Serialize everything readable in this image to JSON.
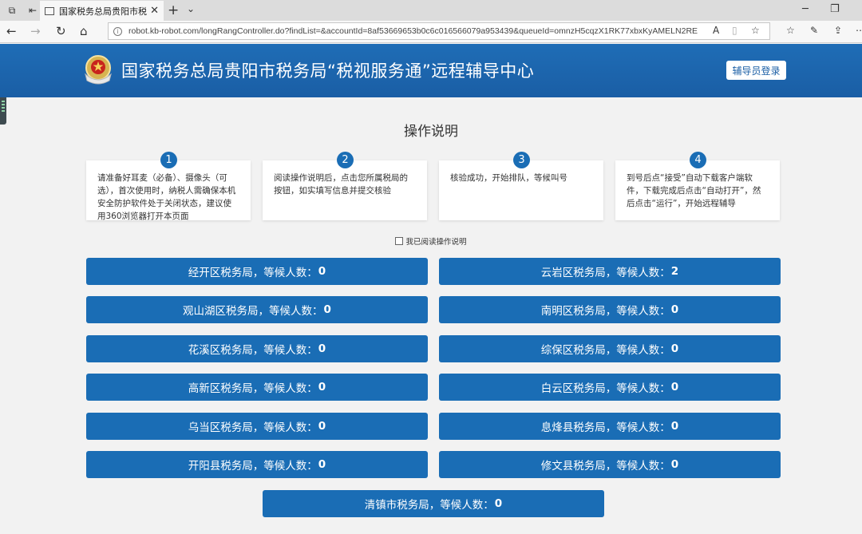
{
  "browser": {
    "tab_title": "国家税务总局贵阳市税务局“税视服务通”远程辅导中心",
    "url": "robot.kb-robot.com/longRangController.do?findList=&accountId=8af53669653b0c6c016566079a953439&queueId=omnzH5cqzX1RK77xbxKyAMELN2RE"
  },
  "header": {
    "title": "国家税务总局贵阳市税务局“税视服务通”远程辅导中心",
    "login_button": "辅导员登录"
  },
  "instructions": {
    "title": "操作说明",
    "steps": [
      {
        "num": "1",
        "text": "请准备好耳麦（必备）、摄像头（可选），首次使用时，纳税人需确保本机安全防护软件处于关闭状态，建议使用360浏览器打开本页面"
      },
      {
        "num": "2",
        "text": "阅读操作说明后，点击您所属税局的按钮，如实填写信息并提交核验"
      },
      {
        "num": "3",
        "text": "核验成功，开始排队，等候叫号"
      },
      {
        "num": "4",
        "text": "到号后点“接受”自动下载客户端软件，下载完成后点击“自动打开”，然后点击“运行”，开始远程辅导"
      }
    ],
    "agree_label": "我已阅读操作说明"
  },
  "queue_label": "，等候人数：",
  "bureaus": [
    {
      "name": "经开区税务局",
      "count": "0"
    },
    {
      "name": "云岩区税务局",
      "count": "2"
    },
    {
      "name": "观山湖区税务局",
      "count": "0"
    },
    {
      "name": "南明区税务局",
      "count": "0"
    },
    {
      "name": "花溪区税务局",
      "count": "0"
    },
    {
      "name": "综保区税务局",
      "count": "0"
    },
    {
      "name": "高新区税务局",
      "count": "0"
    },
    {
      "name": "白云区税务局",
      "count": "0"
    },
    {
      "name": "乌当区税务局",
      "count": "0"
    },
    {
      "name": "息烽县税务局",
      "count": "0"
    },
    {
      "name": "开阳县税务局",
      "count": "0"
    },
    {
      "name": "修文县税务局",
      "count": "0"
    },
    {
      "name": "清镇市税务局",
      "count": "0"
    }
  ],
  "colors": {
    "accent": "#1a6db5",
    "header": "#1f6db6",
    "background": "#f2f2f2"
  }
}
